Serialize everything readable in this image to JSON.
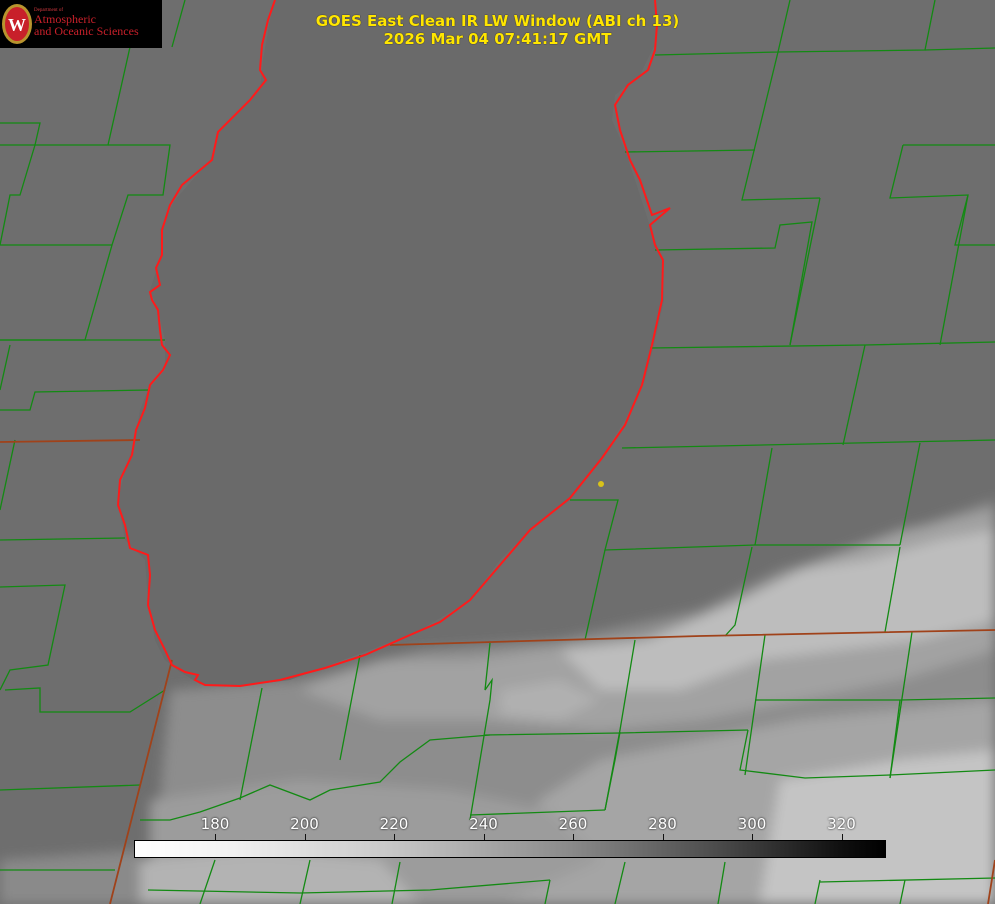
{
  "header": {
    "title_line1": "GOES East Clean IR LW Window (ABI ch 13)",
    "title_line2": "2026 Mar 04 07:41:17 GMT"
  },
  "logo": {
    "dept": "Department of",
    "line1": "Atmospheric",
    "line2": "and Oceanic Sciences",
    "emblem_icon": "uw-crest-icon"
  },
  "colorbar": {
    "ticks": [
      "180",
      "200",
      "220",
      "240",
      "260",
      "280",
      "300",
      "320"
    ],
    "gradient": "white-to-black"
  },
  "colors": {
    "county_lines": "#138a13",
    "state_lines": "#a0421a",
    "lake_outline": "#ff1a1a",
    "title_text": "#ffe600",
    "station_dot": "#d8c21a"
  }
}
